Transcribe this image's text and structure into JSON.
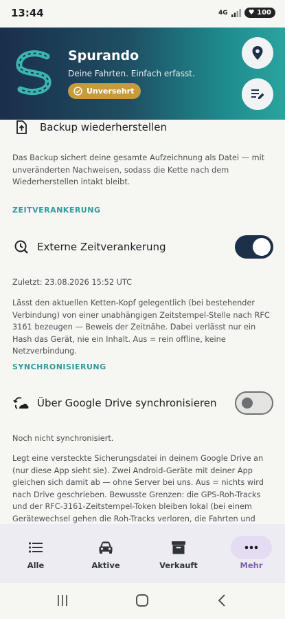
{
  "status_bar": {
    "time": "13:44",
    "network": "4G",
    "battery": "100"
  },
  "header": {
    "title": "Spurando",
    "subtitle": "Deine Fahrten. Einfach erfasst.",
    "badge": "Unversehrt",
    "icons": {
      "location": "location-pin-icon",
      "edit": "edit-list-icon"
    }
  },
  "backup": {
    "restore_label": "Backup wiederherstellen",
    "description": "Das Backup sichert deine gesamte Aufzeichnung als Datei — mit unveränderten Nachweisen, sodass die Kette nach dem Wiederherstellen intakt bleibt."
  },
  "time_anchoring": {
    "section_title": "ZEITVERANKERUNG",
    "label": "Externe Zeitverankerung",
    "enabled": true,
    "last": "Zuletzt: 23.08.2026 15:52 UTC",
    "description": "Lässt den aktuellen Ketten-Kopf gelegentlich (bei bestehender Verbindung) von einer unabhängigen Zeitstempel-Stelle nach RFC 3161 bezeugen — Beweis der Zeitnähe. Dabei verlässt nur ein Hash das Gerät, nie ein Inhalt. Aus = rein offline, keine Netzverbindung."
  },
  "sync": {
    "section_title": "SYNCHRONISIERUNG",
    "label": "Über Google Drive synchronisieren",
    "enabled": false,
    "status": "Noch nicht synchronisiert.",
    "description": "Legt eine versteckte Sicherungsdatei in deinem Google Drive an (nur diese App sieht sie). Zwei Android-Geräte mit deiner App gleichen sich damit ab — ohne Server bei uns. Aus = nichts wird nach Drive geschrieben. Bewusste Grenzen: die GPS-Roh-Tracks und der RFC-3161-Zeitstempel-Token bleiben lokal (bei einem Gerätewechsel gehen die Roh-Tracks verloren, die Fahrten und Beweise selbst nicht)."
  },
  "bottom_nav": {
    "items": [
      {
        "label": "Alle",
        "icon": "list-icon"
      },
      {
        "label": "Aktive",
        "icon": "car-icon"
      },
      {
        "label": "Verkauft",
        "icon": "archive-icon"
      },
      {
        "label": "Mehr",
        "icon": "more-icon"
      }
    ],
    "active_index": 3
  },
  "colors": {
    "accent": "#2f9a9c",
    "badge": "#c79b3c",
    "toggle_on": "#1d3049",
    "nav_active": "#7b5fb0"
  }
}
